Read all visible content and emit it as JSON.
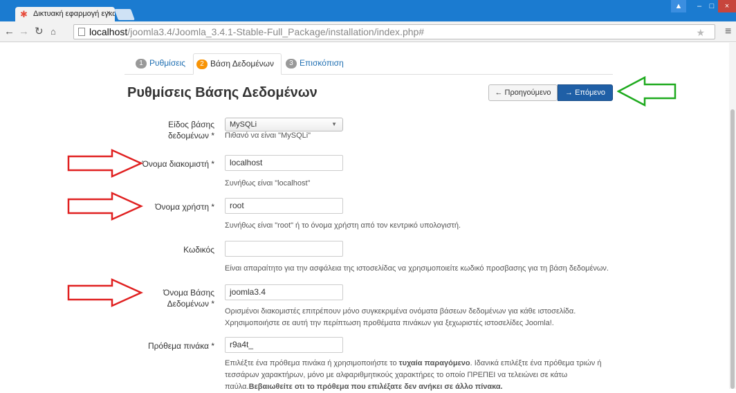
{
  "browser": {
    "tab_title": "Δικτυακή εφαρμογή εγκα",
    "tab_close": "×",
    "address_host": "localhost",
    "address_path": "/joomla3.4/Joomla_3.4.1-Stable-Full_Package/installation/index.php#"
  },
  "steps": [
    {
      "number": "1",
      "label": "Ρυθμίσεις"
    },
    {
      "number": "2",
      "label": "Βάση Δεδομένων"
    },
    {
      "number": "3",
      "label": "Επισκόπιση"
    }
  ],
  "page": {
    "title": "Ρυθμίσεις Βάσης Δεδομένων",
    "prev_label": "← Προηγούμενο",
    "next_label": "→ Επόμενο"
  },
  "form": {
    "db_type": {
      "label_line1": "Είδος βάσης",
      "label_line2": "δεδομένων *",
      "value": "MySQLi",
      "help": "Πιθανό να είναι \"MySQLi\""
    },
    "host": {
      "label": "Όνομα διακομιστή *",
      "value": "localhost",
      "help": "Συνήθως είναι \"localhost\""
    },
    "user": {
      "label": "Όνομα χρήστη *",
      "value": "root",
      "help": "Συνήθως είναι \"root\" ή το όνομα χρήστη από τον κεντρικό υπολογιστή."
    },
    "password": {
      "label": "Κωδικός",
      "value": "",
      "help": "Είναι απαραίτητο για την ασφάλεια της ιστοσελίδας να χρησιμοποιείτε κωδικό προσβασης για τη βάση δεδομένων."
    },
    "db_name": {
      "label_line1": "Όνομα Βάσης",
      "label_line2": "Δεδομένων *",
      "value": "joomla3.4",
      "help_line1": "Ορισμένοι διακομιστές επιτρέπουν μόνο συγκεκριμένα ονόματα βάσεων δεδομένων για κάθε ιστοσελίδα.",
      "help_line2": "Χρησιμοποιήστε σε αυτή την περίπτωση προθέματα πινάκων για ξεχωριστές ιστοσελίδες Joomla!."
    },
    "prefix": {
      "label": "Πρόθεμα πινάκα *",
      "value": "r9a4t_",
      "help_line1_a": "Επιλέξτε ένα πρόθεμα πινάκα ή χρησιμοποιήστε το ",
      "help_line1_b": "τυχαία παραγόμενο",
      "help_line1_c": ". Ιδανικά επιλέξτε ένα πρόθεμα τριών ή",
      "help_line2": "τεσσάρων χαρακτήρων, μόνο με αλφαριθμητικούς χαρακτήρες το οποίο ΠΡΕΠΕΙ να τελειώνει σε κάτω",
      "help_line3_a": "παύλα.",
      "help_line3_b": "Βεβαιωθείτε οτι το πρόθεμα που επιλέξατε δεν ανήκει σε άλλο πίνακα."
    }
  },
  "colors": {
    "annotation_red": "#e02020",
    "annotation_green": "#1eaa1e",
    "primary_button": "#1f5fa6",
    "active_step_badge": "#f89406"
  }
}
